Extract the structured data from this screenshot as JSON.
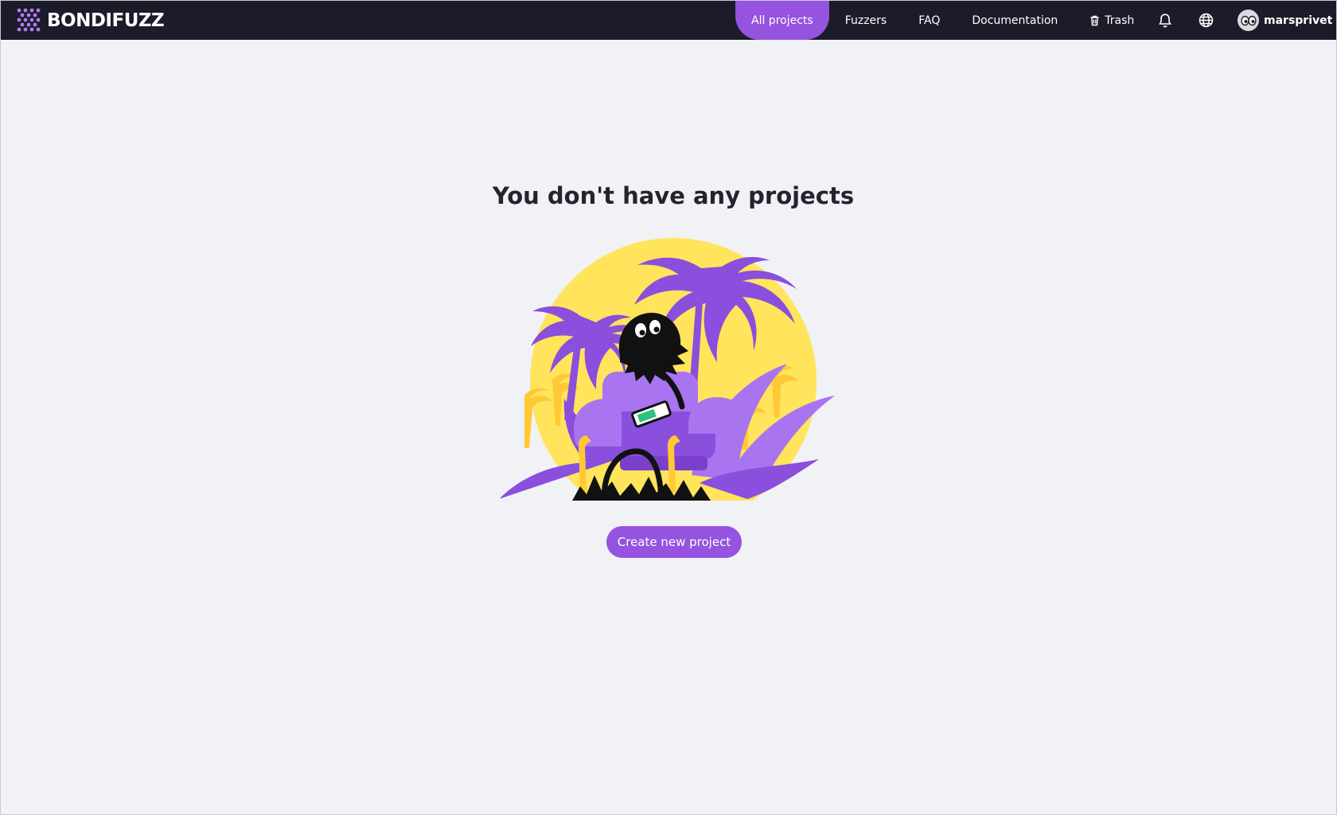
{
  "brand": {
    "name": "BONDIFUZZ"
  },
  "nav": {
    "items": [
      {
        "label": "All projects",
        "active": true
      },
      {
        "label": "Fuzzers",
        "active": false
      },
      {
        "label": "FAQ",
        "active": false
      },
      {
        "label": "Documentation",
        "active": false
      },
      {
        "label": "Trash",
        "active": false,
        "icon": "trash-icon"
      }
    ]
  },
  "header_icons": [
    "bell-icon",
    "globe-icon"
  ],
  "user": {
    "name": "marsprivet",
    "avatar_icon": "eyes-icon"
  },
  "empty_state": {
    "title": "You don't have any projects",
    "illustration": "monster-on-armchair-with-palms-illustration",
    "button_label": "Create new project"
  },
  "colors": {
    "topbar": "#1c1b29",
    "accent": "#9553e0",
    "background": "#f0f2f5",
    "sun": "#ffe45c",
    "palm": "#8a4fdc"
  }
}
